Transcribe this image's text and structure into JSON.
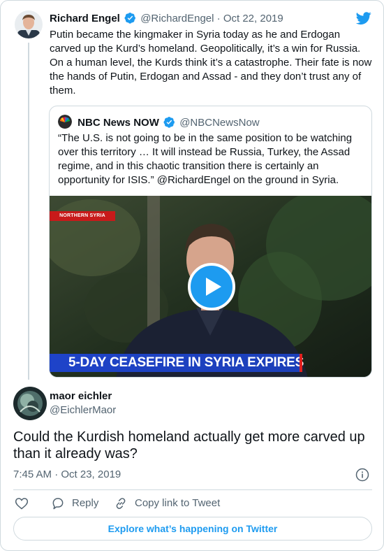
{
  "parent_tweet": {
    "name": "Richard Engel",
    "handle": "@RichardEngel",
    "separator": "·",
    "date": "Oct 22, 2019",
    "text": "Putin became the kingmaker in Syria today as he and Erdogan carved up the Kurd’s homeland.  Geopolitically, it’s a win for Russia. On a human level, the Kurds think it’s a catastrophe.  Their fate is now the hands of Putin, Erdogan and Assad - and they don’t trust any of them."
  },
  "quoted_tweet": {
    "name": "NBC News NOW",
    "handle": "@NBCNewsNow",
    "text": "“The U.S. is not going to be in the same position to be watching over this territory … It will instead be Russia, Turkey, the Assad regime, and in this chaotic transition there is certainly an opportunity for ISIS.” @RichardEngel on the ground in Syria.",
    "video": {
      "location_tag": "NORTHERN SYRIA",
      "chyron": "5-DAY CEASEFIRE IN SYRIA EXPIRES"
    }
  },
  "reply_tweet": {
    "name": "maor eichler",
    "handle": "@EichlerMaor",
    "text": "Could the Kurdish homeland actually get more carved up than it already was?",
    "timestamp": "7:45 AM · Oct 23, 2019"
  },
  "actions": {
    "reply_label": "Reply",
    "copy_link_label": "Copy link to Tweet"
  },
  "explore_label": "Explore what’s happening on Twitter",
  "icons": {
    "logo": "twitter-bird-icon",
    "verified": "verified-badge-icon",
    "play": "play-icon",
    "info": "info-icon",
    "like": "heart-icon",
    "reply": "reply-bubble-icon",
    "copy_link": "link-icon"
  },
  "colors": {
    "brand": "#1d9bf0",
    "text": "#0f1419",
    "muted": "#536471",
    "border": "#cfd9de",
    "chyron": "#1e43c9",
    "alert_red": "#e02020"
  }
}
